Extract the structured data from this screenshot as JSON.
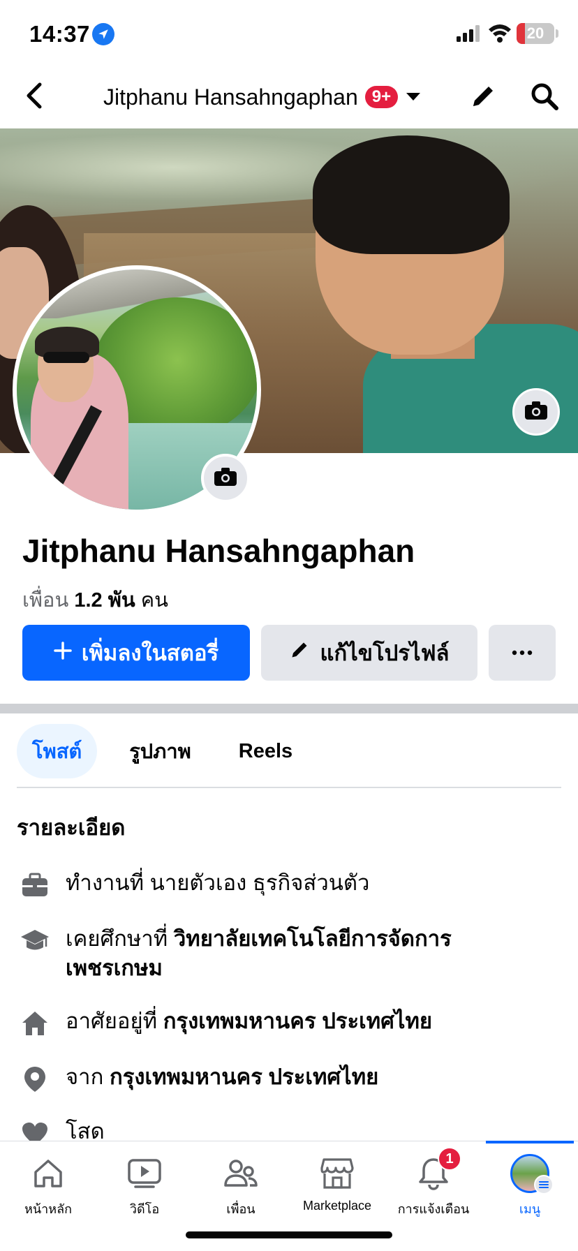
{
  "status_bar": {
    "time": "14:37",
    "battery": "20",
    "battery_level_percent": 20,
    "icons": [
      "location-arrow-icon",
      "signal-icon",
      "wifi-icon",
      "battery-icon"
    ]
  },
  "top_nav": {
    "title": "Jitphanu Hansahngaphan",
    "badge": "9+",
    "icons": [
      "back-chevron-icon",
      "caret-down-icon",
      "pencil-icon",
      "search-icon"
    ]
  },
  "profile": {
    "name": "Jitphanu Hansahngaphan",
    "friends_label": "เพื่อน",
    "friends_count": "1.2 พัน",
    "friends_unit": "คน"
  },
  "actions": {
    "add_story": "เพิ่มลงในสตอรี่",
    "edit_profile": "แก้ไขโปรไฟล์",
    "more": "···"
  },
  "tabs": [
    {
      "label": "โพสต์",
      "active": true
    },
    {
      "label": "รูปภาพ",
      "active": false
    },
    {
      "label": "Reels",
      "active": false
    }
  ],
  "details": {
    "heading": "รายละเอียด",
    "rows": [
      {
        "icon": "briefcase-icon",
        "label": "ทำงานที่",
        "value": "นายตัวเอง ธุรกิจส่วนตัว"
      },
      {
        "icon": "graduation-cap-icon",
        "label": "เคยศึกษาที่",
        "value": "วิทยาลัยเทคโนโลยีการจัดการเพชรเกษม"
      },
      {
        "icon": "house-icon",
        "label": "อาศัยอยู่ที่",
        "value": "กรุงเทพมหานคร ประเทศไทย"
      },
      {
        "icon": "location-pin-icon",
        "label": "จาก",
        "value": "กรุงเทพมหานคร ประเทศไทย"
      },
      {
        "icon": "heart-icon",
        "label": "โสด",
        "value": ""
      }
    ]
  },
  "bottom_nav": [
    {
      "label": "หน้าหลัก",
      "icon": "home-icon",
      "active": false
    },
    {
      "label": "วิดีโอ",
      "icon": "video-icon",
      "active": false
    },
    {
      "label": "เพื่อน",
      "icon": "friends-icon",
      "active": false
    },
    {
      "label": "Marketplace",
      "icon": "marketplace-icon",
      "active": false
    },
    {
      "label": "การแจ้งเตือน",
      "icon": "bell-icon",
      "active": false,
      "badge": "1"
    },
    {
      "label": "เมนู",
      "icon": "menu-avatar-icon",
      "active": true
    }
  ],
  "colors": {
    "accent": "#0866ff",
    "badge": "#e41e3f",
    "button_secondary": "#e4e6eb",
    "tab_active_bg": "#ebf5ff"
  }
}
